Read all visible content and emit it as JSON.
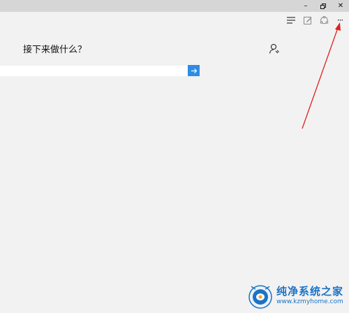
{
  "window": {
    "minimize_label": "–",
    "restore_label": "⧉",
    "close_label": "✕"
  },
  "toolbar": {
    "icons": [
      "hub-icon",
      "web-note-icon",
      "share-icon",
      "more-icon"
    ],
    "more_label": "···"
  },
  "new_tab": {
    "prompt": "接下来做什么？",
    "search_value": "",
    "search_placeholder": ""
  },
  "watermark": {
    "title": "纯净系统之家",
    "url": "www.kzmyhome.com"
  },
  "colors": {
    "accent": "#2d8ce6",
    "titlebar": "#d6d6d6",
    "background": "#f2f2f2",
    "annotation": "#e02020",
    "watermark": "#1c73c6"
  }
}
